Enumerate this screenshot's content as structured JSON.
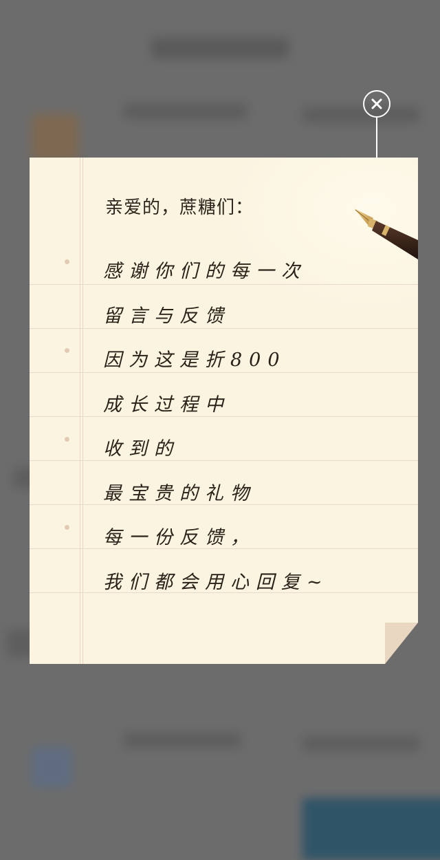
{
  "note": {
    "greeting": "亲爱的，蔗糖们：",
    "lines": [
      "感谢你们的每一次",
      "留言与反馈",
      "因为这是折800",
      "成长过程中",
      "收到的",
      "最宝贵的礼物",
      "每一份反馈，",
      "我们都会用心回复~"
    ]
  },
  "icons": {
    "close": "close-icon",
    "pen": "fountain-pen-icon"
  },
  "colors": {
    "paper": "#fbf4e1",
    "overlay": "#6c6c6c",
    "ink": "#2a2118"
  }
}
